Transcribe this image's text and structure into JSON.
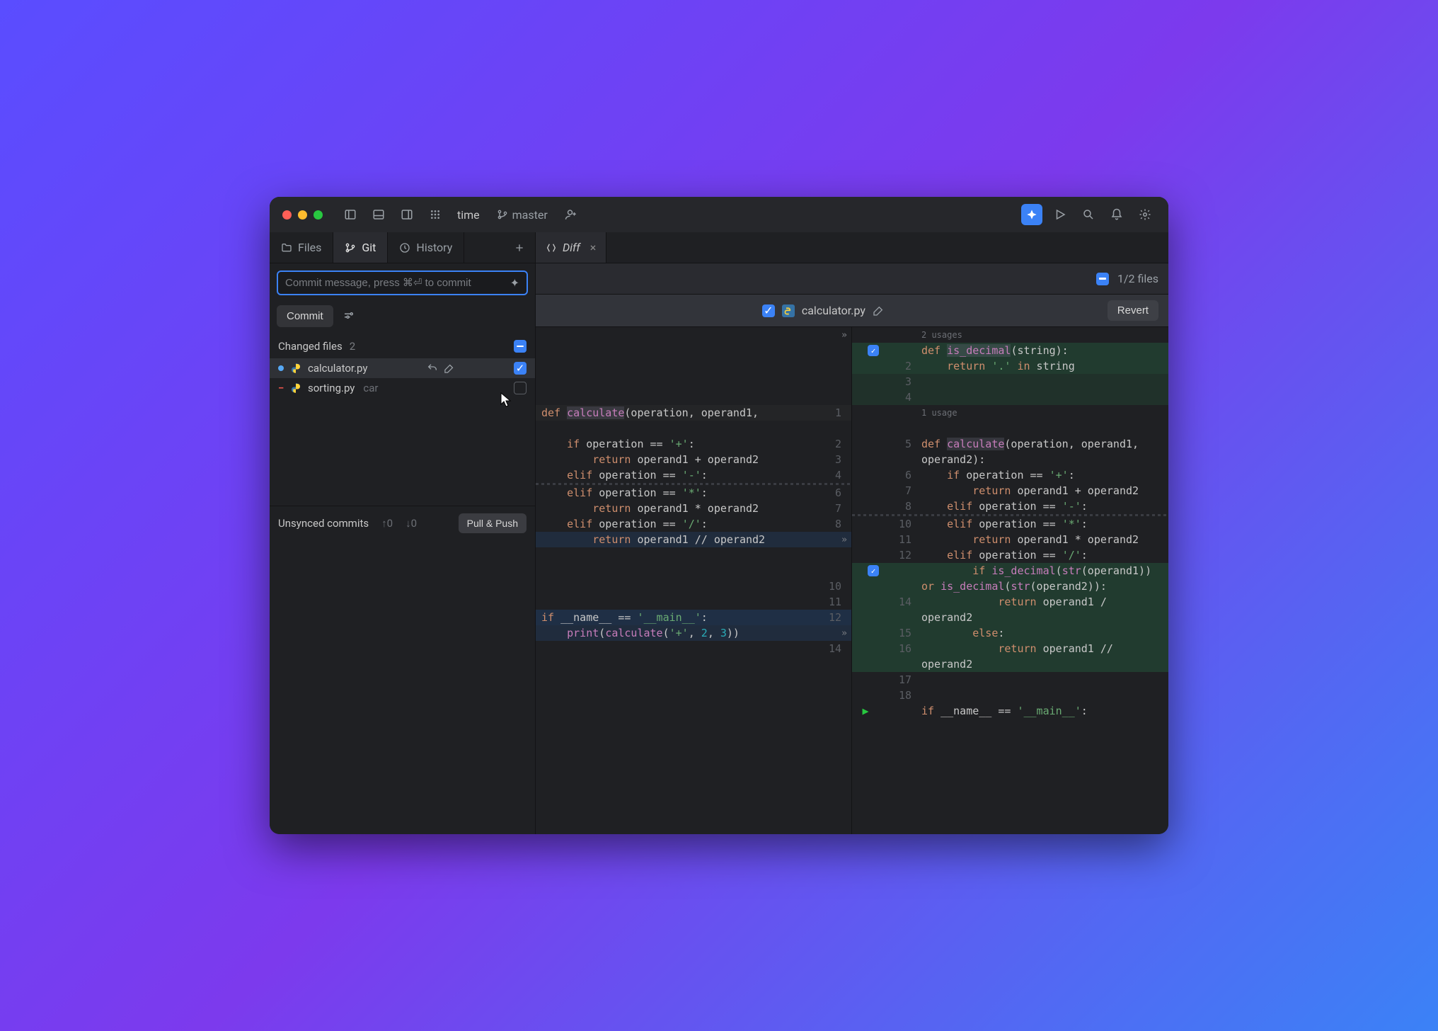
{
  "titlebar": {
    "project": "time",
    "branch": "master"
  },
  "tabs": {
    "files": "Files",
    "git": "Git",
    "history": "History",
    "editor_tab": "Diff"
  },
  "commit": {
    "placeholder": "Commit message, press ⌘⏎ to commit",
    "button": "Commit"
  },
  "changes": {
    "header": "Changed files",
    "count": "2",
    "files": [
      {
        "name": "calculator.py",
        "status": "modified",
        "checked": true,
        "selected": true
      },
      {
        "name": "sorting.py",
        "status": "deleted",
        "checked": false,
        "extra": "car"
      }
    ]
  },
  "unsynced": {
    "label": "Unsynced commits",
    "up": "↑0",
    "down": "↓0",
    "button": "Pull & Push"
  },
  "diff": {
    "files_count": "1/2 files",
    "file_name": "calculator.py",
    "revert": "Revert",
    "usages_top": "2 usages",
    "usages_mid": "1 usage",
    "left_lines": [
      {
        "n": "",
        "t": ""
      },
      {
        "n": "",
        "t": ""
      },
      {
        "n": "",
        "t": ""
      },
      {
        "n": "",
        "t": ""
      },
      {
        "n": "1",
        "t": "def calculate(operation, operand1, ",
        "cls": "bg-hint",
        "isdef": true
      },
      {
        "n": "",
        "t": ""
      },
      {
        "n": "2",
        "t": "    if operation == '+':"
      },
      {
        "n": "3",
        "t": "        return operand1 + operand2"
      },
      {
        "n": "4",
        "t": "    elif operation == '-':"
      }
    ],
    "left_lines2": [
      {
        "n": "6",
        "t": "    elif operation == '*':"
      },
      {
        "n": "7",
        "t": "        return operand1 * operand2"
      },
      {
        "n": "8",
        "t": "    elif operation == '/':"
      },
      {
        "n": "",
        "t": "        return operand1 // operand2",
        "cls": "bg-del",
        "chev": true
      },
      {
        "n": "",
        "t": ""
      },
      {
        "n": "",
        "t": ""
      },
      {
        "n": "10",
        "t": ""
      },
      {
        "n": "11",
        "t": ""
      },
      {
        "n": "12",
        "t": "if __name__ == '__main__':",
        "cls": "bg-mod"
      },
      {
        "n": "",
        "t": "    print(calculate('+', 2, 3))",
        "cls": "bg-del",
        "chev": true
      },
      {
        "n": "14",
        "t": ""
      }
    ],
    "right_lines": [
      {
        "n": "",
        "t": "def is_decimal(string):",
        "cls": "bg-add",
        "chk": true,
        "isdef": true
      },
      {
        "n": "2",
        "t": "    return '.' in string",
        "cls": "bg-add"
      },
      {
        "n": "3",
        "t": "",
        "cls": "bg-add-dark"
      },
      {
        "n": "4",
        "t": "",
        "cls": "bg-add-dark"
      },
      {
        "n": "",
        "t": ""
      },
      {
        "n": "5",
        "t": "def calculate(operation, operand1,",
        "isdef": true
      },
      {
        "n": "",
        "t": "operand2):"
      },
      {
        "n": "6",
        "t": "    if operation == '+':"
      },
      {
        "n": "7",
        "t": "        return operand1 + operand2"
      },
      {
        "n": "8",
        "t": "    elif operation == '-':"
      }
    ],
    "right_lines2": [
      {
        "n": "10",
        "t": "    elif operation == '*':"
      },
      {
        "n": "11",
        "t": "        return operand1 * operand2"
      },
      {
        "n": "12",
        "t": "    elif operation == '/':"
      },
      {
        "n": "",
        "t": "        if is_decimal(str(operand1))",
        "cls": "bg-add",
        "chk": true
      },
      {
        "n": "",
        "t": "or is_decimal(str(operand2)):",
        "cls": "bg-add"
      },
      {
        "n": "14",
        "t": "            return operand1 /",
        "cls": "bg-add"
      },
      {
        "n": "",
        "t": "operand2",
        "cls": "bg-add"
      },
      {
        "n": "15",
        "t": "        else:",
        "cls": "bg-add"
      },
      {
        "n": "16",
        "t": "            return operand1 //",
        "cls": "bg-add"
      },
      {
        "n": "",
        "t": "operand2",
        "cls": "bg-add"
      },
      {
        "n": "17",
        "t": ""
      },
      {
        "n": "18",
        "t": ""
      },
      {
        "n": "",
        "t": "if __name__ == '__main__':",
        "run": true
      }
    ]
  }
}
